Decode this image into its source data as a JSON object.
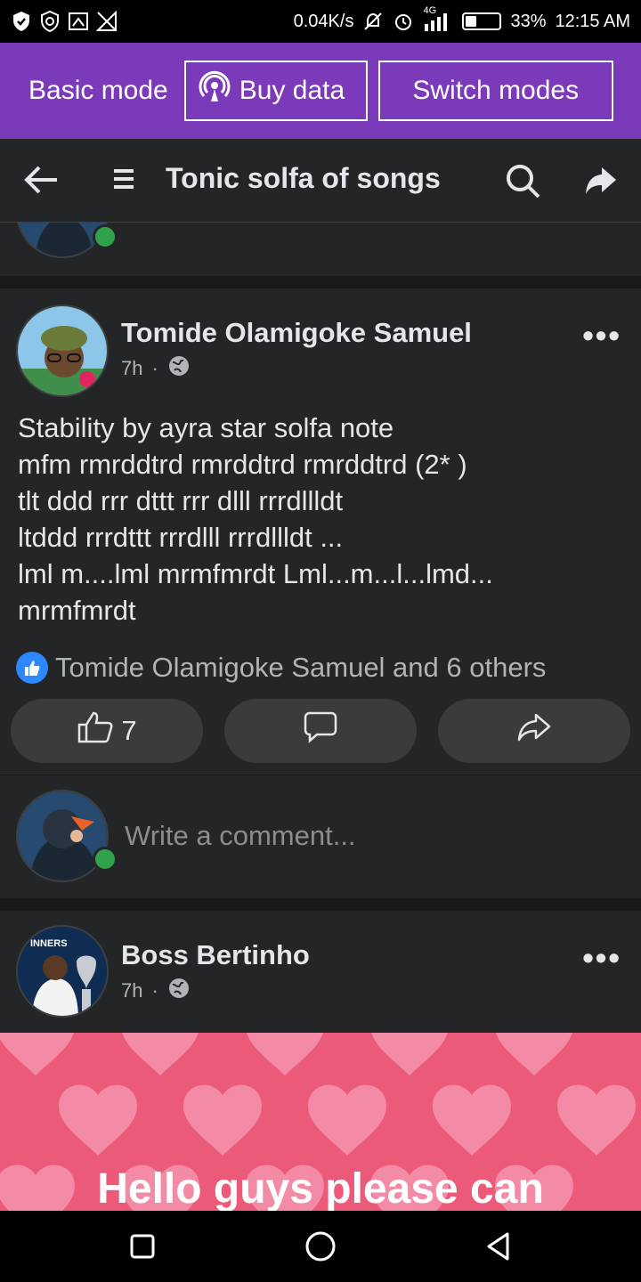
{
  "status_bar": {
    "speed": "0.04K/s",
    "network": "4G",
    "battery": "33%",
    "battery_level": 0.33,
    "time": "12:15 AM"
  },
  "mode_bar": {
    "basic_mode": "Basic mode",
    "buy_data": "Buy data",
    "switch_modes": "Switch modes",
    "bg_color": "#7b3aba"
  },
  "header": {
    "title": "Tonic solfa of songs"
  },
  "post": {
    "author": "Tomide Olamigoke Samuel",
    "time": "7h",
    "lines": [
      "Stability by ayra star solfa note",
      "mfm rmrddtrd rmrddtrd rmrddtrd (2* )",
      "tlt ddd rrr dttt rrr dlll rrrdllldt",
      "ltddd rrrdttt rrrdlll rrrdllldt ...",
      "lml m....lml mrmfmrdt Lml...m...l...lmd...",
      "mrmfmrdt"
    ],
    "reactions_text": "Tomide Olamigoke Samuel and 6 others",
    "like_count": "7"
  },
  "comment": {
    "placeholder": "Write a comment..."
  },
  "post2": {
    "author": "Boss Bertinho",
    "time": "7h",
    "image_caption": "Hello guys please can",
    "avatar_text": "INNERS"
  }
}
